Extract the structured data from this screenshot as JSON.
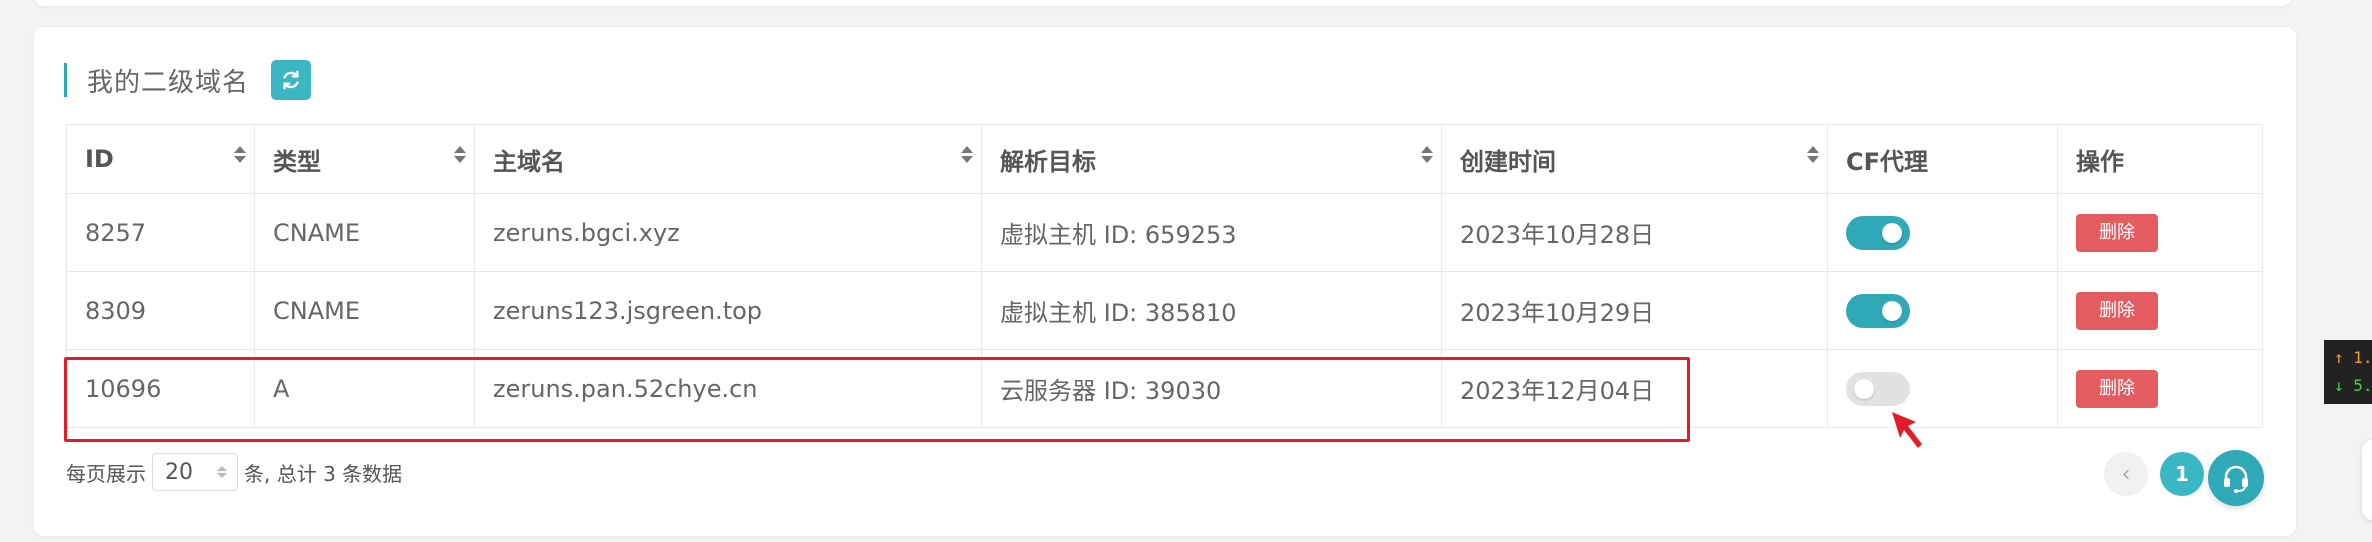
{
  "section": {
    "title": "我的二级域名"
  },
  "table": {
    "columns": [
      "ID",
      "类型",
      "主域名",
      "解析目标",
      "创建时间",
      "CF代理",
      "操作"
    ],
    "rows": [
      {
        "id": "8257",
        "type": "CNAME",
        "domain": "zeruns.bgci.xyz",
        "target": "虚拟主机 ID: 659253",
        "created": "2023年10月28日",
        "cf_proxy": true,
        "action": "删除"
      },
      {
        "id": "8309",
        "type": "CNAME",
        "domain": "zeruns123.jsgreen.top",
        "target": "虚拟主机 ID: 385810",
        "created": "2023年10月29日",
        "cf_proxy": true,
        "action": "删除"
      },
      {
        "id": "10696",
        "type": "A",
        "domain": "zeruns.pan.52chye.cn",
        "target": "云服务器 ID: 39030",
        "created": "2023年12月04日",
        "cf_proxy": false,
        "action": "删除"
      }
    ]
  },
  "footer": {
    "per_page_label": "每页展示",
    "per_page_value": "20",
    "total_text": "条, 总计 3 条数据"
  },
  "pagination": {
    "prev": "‹",
    "current": "1"
  },
  "speed_widget": {
    "up": "↑ 1.",
    "down": "↓ 5."
  },
  "colors": {
    "accent": "#3bb7c3",
    "danger": "#e55c60",
    "highlight": "#e21d2b"
  },
  "icons": [
    "refresh-icon",
    "sort-icon",
    "chevron-left-icon",
    "headset-icon",
    "cursor-arrow-icon"
  ]
}
